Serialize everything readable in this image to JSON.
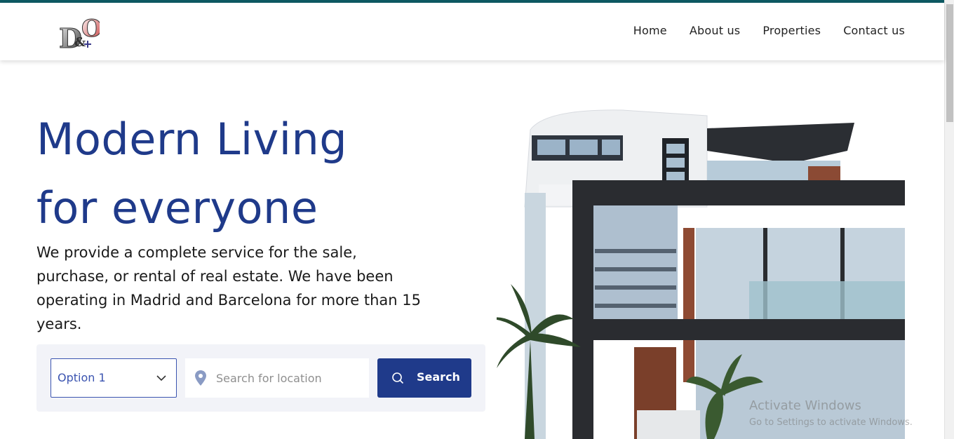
{
  "brand": {
    "logo_text": "D&O",
    "accent": "#1f3a8a",
    "topbar_color": "#0e5a63"
  },
  "nav": {
    "items": [
      "Home",
      "About us",
      "Properties",
      "Contact us"
    ]
  },
  "hero": {
    "title_line1": "Modern Living",
    "title_line2": "for everyone",
    "description": "We provide a complete service for the sale, purchase, or rental of real estate. We have been operating in Madrid and Barcelona for more than 15 years."
  },
  "search": {
    "select_value": "Option 1",
    "location_placeholder": "Search for location",
    "button_label": "Search"
  },
  "watermark": {
    "line1": "Activate Windows",
    "line2": "Go to Settings to activate Windows."
  }
}
